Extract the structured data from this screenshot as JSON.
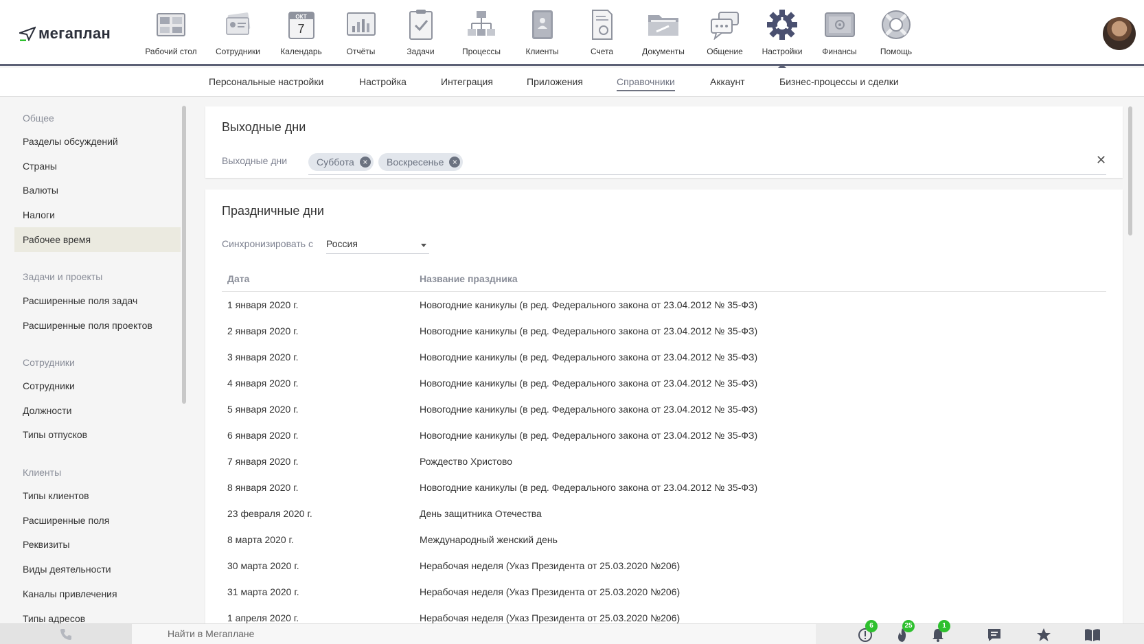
{
  "header": {
    "logo_text": "мегаплан",
    "nav": [
      {
        "label": "Рабочий стол",
        "icon": "desktop-icon"
      },
      {
        "label": "Сотрудники",
        "icon": "employees-icon"
      },
      {
        "label": "Календарь",
        "icon": "calendar-icon",
        "month": "ОКТ",
        "day": "7"
      },
      {
        "label": "Отчёты",
        "icon": "reports-icon"
      },
      {
        "label": "Задачи",
        "icon": "tasks-icon"
      },
      {
        "label": "Процессы",
        "icon": "processes-icon"
      },
      {
        "label": "Клиенты",
        "icon": "clients-icon"
      },
      {
        "label": "Счета",
        "icon": "invoices-icon"
      },
      {
        "label": "Документы",
        "icon": "documents-icon"
      },
      {
        "label": "Общение",
        "icon": "chat-icon"
      },
      {
        "label": "Настройки",
        "icon": "settings-icon",
        "active": true
      },
      {
        "label": "Финансы",
        "icon": "finance-icon"
      },
      {
        "label": "Помощь",
        "icon": "help-icon"
      }
    ]
  },
  "subnav": {
    "items": [
      {
        "label": "Персональные настройки"
      },
      {
        "label": "Настройка"
      },
      {
        "label": "Интеграция"
      },
      {
        "label": "Приложения"
      },
      {
        "label": "Справочники",
        "active": true
      },
      {
        "label": "Аккаунт"
      },
      {
        "label": "Бизнес-процессы и сделки"
      }
    ]
  },
  "sidebar": {
    "groups": [
      {
        "title": "Общее",
        "items": [
          "Разделы обсуждений",
          "Страны",
          "Валюты",
          "Налоги",
          "Рабочее время"
        ]
      },
      {
        "title": "Задачи и проекты",
        "items": [
          "Расширенные поля задач",
          "Расширенные поля проектов"
        ]
      },
      {
        "title": "Сотрудники",
        "items": [
          "Сотрудники",
          "Должности",
          "Типы отпусков"
        ]
      },
      {
        "title": "Клиенты",
        "items": [
          "Типы клиентов",
          "Расширенные поля",
          "Реквизиты",
          "Виды деятельности",
          "Каналы привлечения",
          "Типы адресов"
        ]
      }
    ],
    "active_item": "Рабочее время"
  },
  "weekends": {
    "title": "Выходные дни",
    "field_label": "Выходные дни",
    "chips": [
      "Суббота",
      "Воскресенье"
    ]
  },
  "holidays": {
    "title": "Праздничные дни",
    "sync_label": "Синхронизировать с",
    "sync_value": "Россия",
    "columns": [
      "Дата",
      "Название праздника"
    ],
    "rows": [
      [
        "1 января 2020 г.",
        "Новогодние каникулы (в ред. Федерального закона от 23.04.2012 № 35-ФЗ)"
      ],
      [
        "2 января 2020 г.",
        "Новогодние каникулы (в ред. Федерального закона от 23.04.2012 № 35-ФЗ)"
      ],
      [
        "3 января 2020 г.",
        "Новогодние каникулы (в ред. Федерального закона от 23.04.2012 № 35-ФЗ)"
      ],
      [
        "4 января 2020 г.",
        "Новогодние каникулы (в ред. Федерального закона от 23.04.2012 № 35-ФЗ)"
      ],
      [
        "5 января 2020 г.",
        "Новогодние каникулы (в ред. Федерального закона от 23.04.2012 № 35-ФЗ)"
      ],
      [
        "6 января 2020 г.",
        "Новогодние каникулы (в ред. Федерального закона от 23.04.2012 № 35-ФЗ)"
      ],
      [
        "7 января 2020 г.",
        "Рождество Христово"
      ],
      [
        "8 января 2020 г.",
        "Новогодние каникулы (в ред. Федерального закона от 23.04.2012 № 35-ФЗ)"
      ],
      [
        "23 февраля 2020 г.",
        "День защитника Отечества"
      ],
      [
        "8 марта 2020 г.",
        "Международный женский день"
      ],
      [
        "30 марта 2020 г.",
        "Нерабочая неделя (Указ Президента от 25.03.2020 №206)"
      ],
      [
        "31 марта 2020 г.",
        "Нерабочая неделя (Указ Президента от 25.03.2020 №206)"
      ],
      [
        "1 апреля 2020 г.",
        "Нерабочая неделя (Указ Президента от 25.03.2020 №206)"
      ]
    ]
  },
  "bottombar": {
    "search_placeholder": "Найти в Мегаплане",
    "badges": {
      "alerts": "6",
      "hot": "25",
      "notifications": "1"
    }
  },
  "colors": {
    "accent": "#5b6075",
    "badge": "#2ec02e",
    "chip_bg": "#e2e6ec",
    "active_sidebar": "#ebeae0"
  }
}
